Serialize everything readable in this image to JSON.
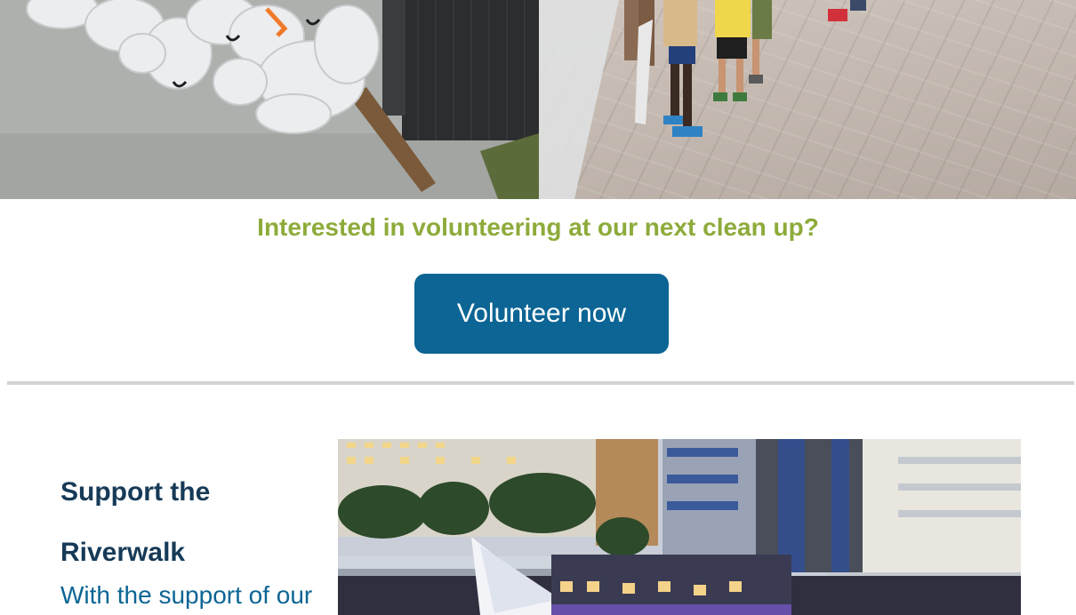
{
  "photos": {
    "left_alt_icon": "trash-bags-photo",
    "right_alt_icon": "volunteers-photo"
  },
  "cta": {
    "heading": "Interested in volunteering at our next clean up?",
    "button_label": "Volunteer now"
  },
  "support": {
    "title_line1": "Support the",
    "title_line2": "Riverwalk",
    "body": "With the support of our",
    "photo_icon": "riverwalk-photo"
  },
  "colors": {
    "heading_green": "#8dab3a",
    "button_blue": "#0c6594",
    "title_navy": "#163a57",
    "divider_gray": "#d3d3d3"
  }
}
